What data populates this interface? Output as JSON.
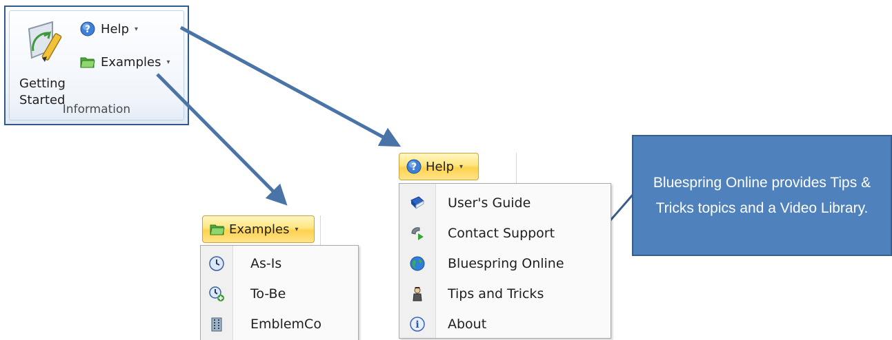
{
  "ribbon": {
    "getting_started_label": "Getting\nStarted",
    "help_label": "Help",
    "examples_label": "Examples",
    "group_label": "Information",
    "dropdown_glyph": "▾"
  },
  "help_menu": {
    "button_label": "Help",
    "items": [
      {
        "label": "User's Guide",
        "icon": "book-icon"
      },
      {
        "label": "Contact Support",
        "icon": "phone-icon"
      },
      {
        "label": "Bluespring Online",
        "icon": "globe-icon"
      },
      {
        "label": "Tips and Tricks",
        "icon": "person-icon"
      },
      {
        "label": "About",
        "icon": "info-icon"
      }
    ]
  },
  "examples_menu": {
    "button_label": "Examples",
    "items": [
      {
        "label": "As-Is",
        "icon": "clock-icon"
      },
      {
        "label": "To-Be",
        "icon": "clock-add-icon"
      },
      {
        "label": "EmblemCo",
        "icon": "building-icon"
      }
    ]
  },
  "callout": {
    "text": "Bluespring Online provides Tips & Tricks topics and a Video Library."
  },
  "colors": {
    "arrow": "#4a74a8",
    "callout_fill": "#4f81bd",
    "menu_button_highlight": "#ffd24e"
  }
}
